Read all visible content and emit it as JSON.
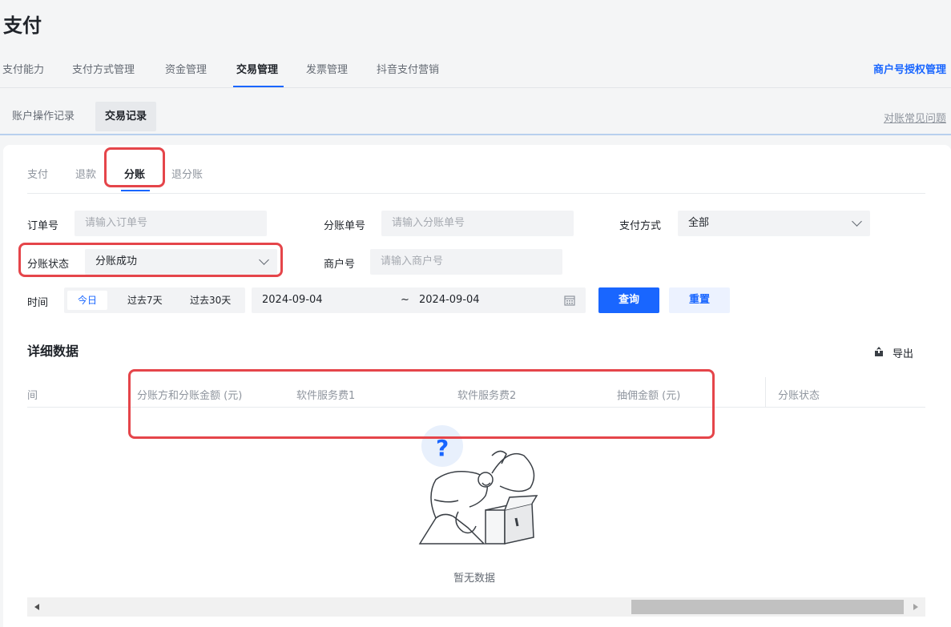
{
  "page": {
    "title": "支付"
  },
  "main_tabs": [
    {
      "label": "支付能力"
    },
    {
      "label": "支付方式管理"
    },
    {
      "label": "资金管理"
    },
    {
      "label": "交易管理",
      "active": true
    },
    {
      "label": "发票管理"
    },
    {
      "label": "抖音支付营销"
    }
  ],
  "merchant_auth_link": "商户号授权管理",
  "sub_tabs": [
    {
      "label": "账户操作记录"
    },
    {
      "label": "交易记录",
      "active": true
    }
  ],
  "faq_link": "对账常见问题",
  "inner_tabs": [
    {
      "label": "支付"
    },
    {
      "label": "退款"
    },
    {
      "label": "分账",
      "active": true
    },
    {
      "label": "退分账"
    }
  ],
  "filters": {
    "order_no": {
      "label": "订单号",
      "placeholder": "请输入订单号"
    },
    "split_no": {
      "label": "分账单号",
      "placeholder": "请输入分账单号"
    },
    "pay_method": {
      "label": "支付方式",
      "value": "全部"
    },
    "split_status": {
      "label": "分账状态",
      "value": "分账成功"
    },
    "merchant_no": {
      "label": "商户号",
      "placeholder": "请输入商户号"
    },
    "time": {
      "label": "时间",
      "options": [
        "今日",
        "过去7天",
        "过去30天"
      ],
      "active": "今日",
      "start": "2024-09-04",
      "separator": "~",
      "end": "2024-09-04"
    }
  },
  "buttons": {
    "query": "查询",
    "reset": "重置",
    "export": "导出"
  },
  "section_title": "详细数据",
  "table": {
    "columns": [
      "间",
      "分账方和分账金额 (元)",
      "软件服务费1",
      "软件服务费2",
      "抽佣金额 (元)",
      "分账状态"
    ],
    "empty_text": "暂无数据"
  },
  "colors": {
    "accent": "#1966ff",
    "annotation": "#e5454a"
  }
}
